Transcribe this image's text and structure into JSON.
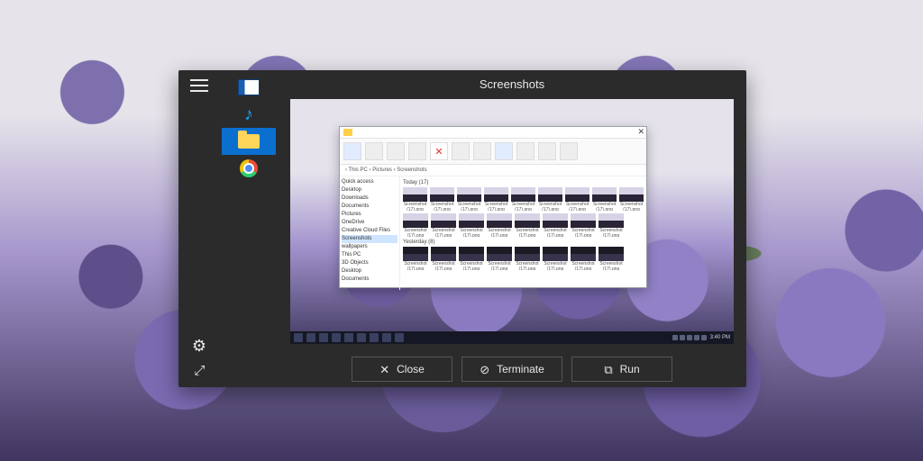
{
  "panel": {
    "title": "Screenshots",
    "rail": [
      {
        "name": "task-view",
        "selected": false
      },
      {
        "name": "music",
        "selected": false
      },
      {
        "name": "file-explorer",
        "selected": true
      },
      {
        "name": "chrome",
        "selected": false
      }
    ],
    "buttons": {
      "close": "Close",
      "terminate": "Terminate",
      "run": "Run"
    }
  },
  "preview": {
    "explorer": {
      "address": "› This PC › Pictures › Screenshots",
      "nav": [
        "Quick access",
        "Desktop",
        "Downloads",
        "Documents",
        "Pictures",
        "OneDrive",
        "Creative Cloud Files",
        "Screenshots",
        "wallpapers",
        "This PC",
        "3D Objects",
        "Desktop",
        "Documents"
      ],
      "nav_selected": "Screenshots",
      "groups": [
        {
          "header": "Today (17)",
          "count_row1": 9,
          "count_row2": 8,
          "style": "light"
        },
        {
          "header": "Yesterday (8)",
          "count_row1": 8,
          "style": "dark"
        }
      ],
      "thumb_label": "Screenshot (17).png"
    },
    "taskbar": {
      "clock": "3:40 PM"
    }
  }
}
